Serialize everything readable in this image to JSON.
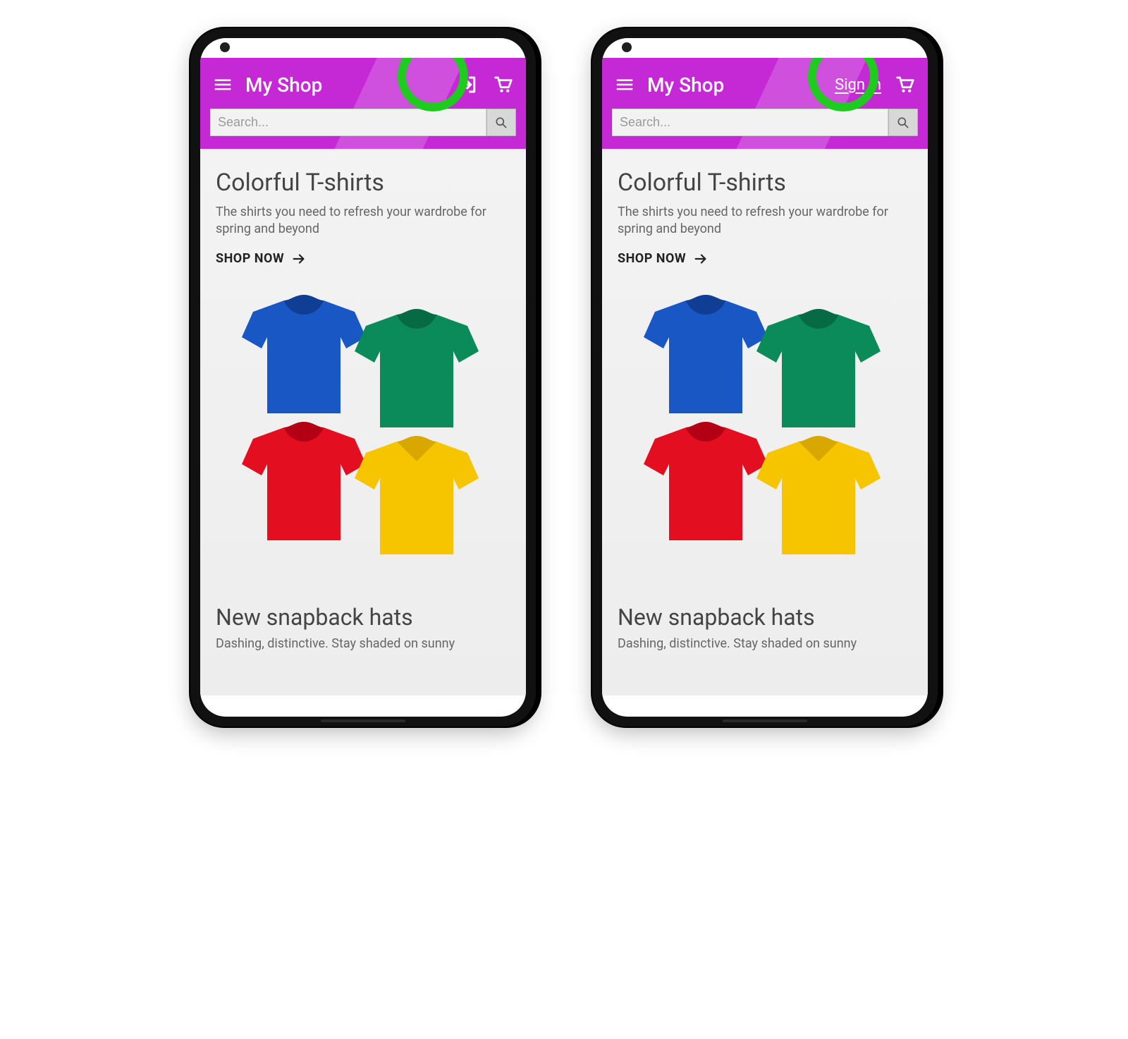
{
  "header": {
    "title": "My Shop",
    "sign_in": "Sign in"
  },
  "search": {
    "placeholder": "Search..."
  },
  "hero": {
    "title": "Colorful T-shirts",
    "subtitle": "The shirts you need to refresh your wardrobe for spring and beyond",
    "cta": "SHOP NOW"
  },
  "section2": {
    "title": "New snapback hats",
    "subtitle": "Dashing, distinctive. Stay shaded on sunny"
  }
}
